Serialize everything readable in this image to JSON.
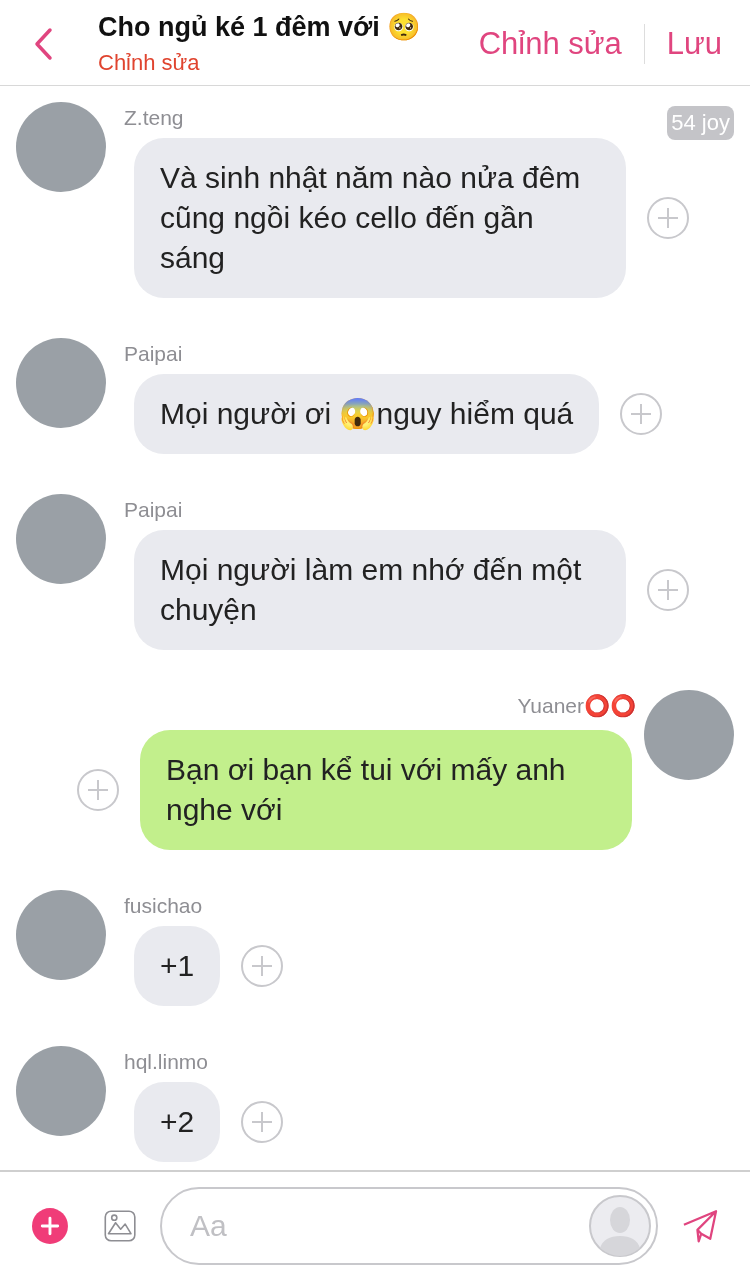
{
  "header": {
    "title": "Cho ngủ ké 1 đêm với 🥺",
    "subtitle": "Chỉnh sửa",
    "actions": [
      "Chỉnh sửa",
      "Lưu"
    ]
  },
  "messages": [
    {
      "kind": "incoming",
      "sender": "Z.teng",
      "text": "Và sinh nhật năm nào nửa đêm cũng ngồi kéo cello đến gần sáng",
      "badge": "54 joy"
    },
    {
      "kind": "incoming",
      "sender": "Paipai",
      "text": "Mọi người ơi 😱nguy hiểm quá"
    },
    {
      "kind": "incoming",
      "sender": "Paipai",
      "text": "Mọi người làm em nhớ đến một chuyện"
    },
    {
      "kind": "outgoing",
      "sender": "Yuaner⭕⭕",
      "text": "Bạn ơi bạn kể tui với mấy anh nghe với"
    },
    {
      "kind": "incoming",
      "sender": "fusichao",
      "text": "+1"
    },
    {
      "kind": "incoming",
      "sender": "hql.linmo",
      "text": "+2"
    }
  ],
  "composer": {
    "placeholder": "Aa"
  }
}
